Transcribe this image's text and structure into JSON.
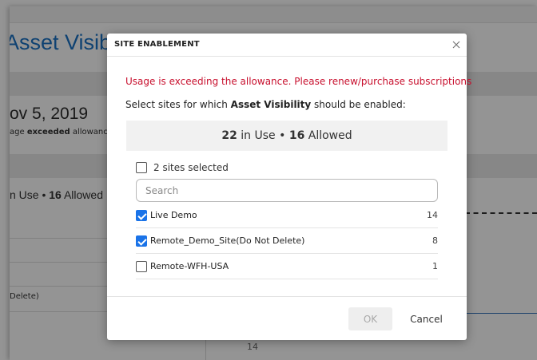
{
  "background": {
    "title": "Asset Visib",
    "date": "ov 5, 2019",
    "usage_prefix": "age ",
    "usage_bold": "exceeded",
    "usage_suffix": " allowanc",
    "in_use_prefix": "n Use • ",
    "in_use_allowed": "16",
    "in_use_suffix": " Allowed",
    "site_fragment": "Delete)",
    "axis_tick": "14"
  },
  "modal": {
    "title": "SITE ENABLEMENT",
    "alert": "Usage is exceeding the allowance. Please renew/purchase subscriptions",
    "instruction_prefix": "Select sites for which ",
    "instruction_bold": "Asset Visibility",
    "instruction_suffix": " should be enabled:",
    "usage": {
      "in_use": "22",
      "in_use_label": " in Use • ",
      "allowed": "16",
      "allowed_label": " Allowed"
    },
    "select_all_label": "2 sites selected",
    "search": {
      "placeholder": "Search",
      "value": ""
    },
    "sites": [
      {
        "name": "Live Demo",
        "count": "14",
        "checked": true
      },
      {
        "name": "Remote_Demo_Site(Do Not Delete)",
        "count": "8",
        "checked": true
      },
      {
        "name": "Remote-WFH-USA",
        "count": "1",
        "checked": false
      }
    ],
    "ok_label": "OK",
    "cancel_label": "Cancel"
  },
  "colors": {
    "alert": "#c8102e",
    "checkbox_accent": "#1a73e8",
    "title_blue": "#1a72c4"
  },
  "icons": {
    "close": "close-icon",
    "check": "checkmark-icon"
  }
}
